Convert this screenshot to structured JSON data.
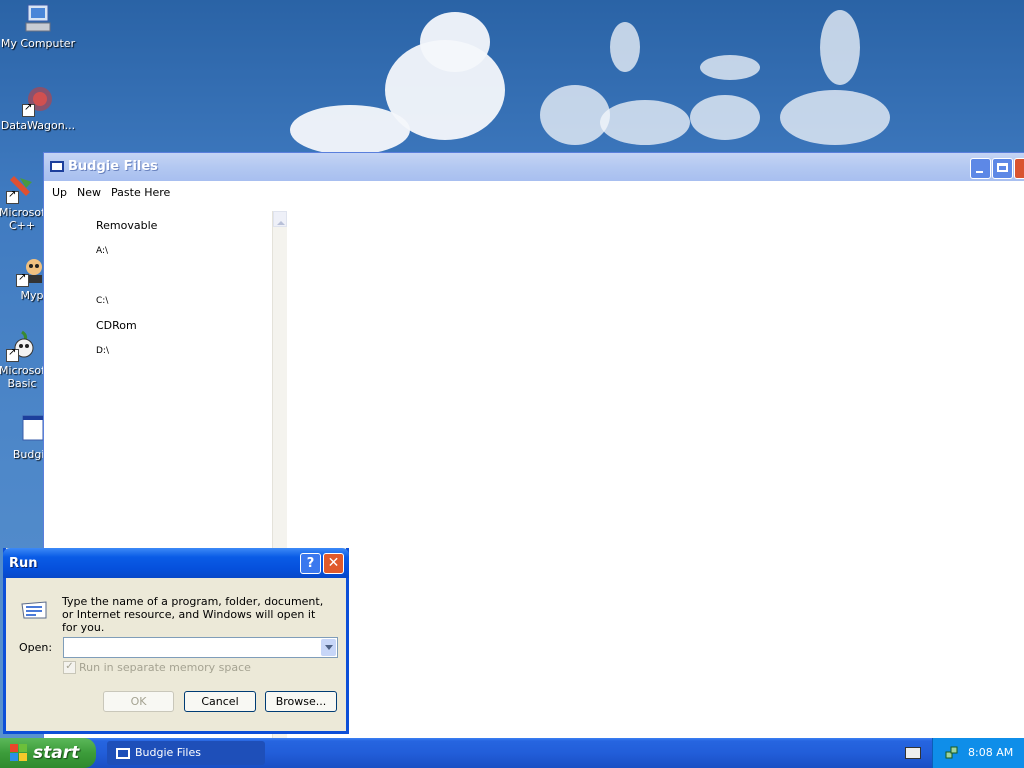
{
  "desktop": {
    "icons": [
      {
        "label": "My Computer",
        "icon": "my-computer-icon"
      },
      {
        "label": "DataWagon...",
        "icon": "datawagon-icon"
      },
      {
        "label": "Microsof\nC++",
        "icon": "microsoft-cpp-icon"
      },
      {
        "label": "Myp",
        "icon": "myp-icon"
      },
      {
        "label": "Microsof\nBasic",
        "icon": "microsoft-basic-icon"
      },
      {
        "label": "Budgie",
        "icon": "budgie-icon"
      }
    ]
  },
  "window": {
    "title": "Budgie Files",
    "menu": [
      "Up",
      "New",
      "Paste Here"
    ],
    "tree": [
      {
        "label": "Removable",
        "drive": "A:\\"
      },
      {
        "label": "",
        "drive": "C:\\"
      },
      {
        "label": "CDRom",
        "drive": "D:\\"
      }
    ]
  },
  "run_dialog": {
    "title": "Run",
    "help_label": "?",
    "close_label": "✕",
    "message": "Type the name of a program, folder, document, or Internet resource, and Windows will open it for you.",
    "open_label": "Open:",
    "open_value": "",
    "checkbox_label": "Run in separate memory space",
    "checkbox_checked": true,
    "ok_label": "OK",
    "cancel_label": "Cancel",
    "browse_label": "Browse..."
  },
  "taskbar": {
    "start_label": "start",
    "tasks": [
      {
        "label": "Budgie Files"
      }
    ],
    "clock": "8:08 AM"
  },
  "colors": {
    "titlebar_inactive": "#a8bff0",
    "titlebar_active": "#0550dc",
    "taskbar": "#225ed9",
    "start_green": "#3c9c3a"
  }
}
